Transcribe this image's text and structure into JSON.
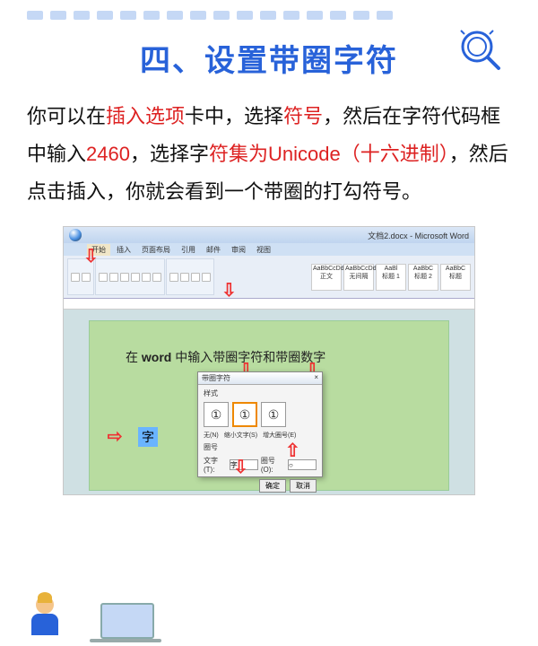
{
  "title": "四、设置带圈字符",
  "paragraph": {
    "p1a": "你可以在",
    "p1b": "插入选项",
    "p1c": "卡中，选择",
    "p1d": "符号",
    "p1e": "，然后在字符代码框中输入",
    "p1f": "2460",
    "p1g": "，选择字",
    "p1h": "符集为Unicode（十六进制）",
    "p1i": "，然后点击插入，你就会看到一个带圈的打勾符号。"
  },
  "word": {
    "window_title": "文档2.docx - Microsoft Word",
    "tabs": [
      "开始",
      "插入",
      "页面布局",
      "引用",
      "邮件",
      "审阅",
      "视图"
    ],
    "style_labels": [
      "AaBbCcDd",
      "AaBbCcDd",
      "AaBl",
      "AaBbC",
      "AaBbC"
    ],
    "style_names": [
      "正文",
      "无间隔",
      "标题 1",
      "标题 2",
      "标题"
    ],
    "page_text_a": "在 ",
    "page_text_b": "word",
    "page_text_c": " 中输入带圈字符和带圈数字",
    "highlighted_char": "字",
    "dialog": {
      "title": "带圈字符",
      "close": "×",
      "section": "样式",
      "options": [
        "①",
        "①",
        "①"
      ],
      "option_labels": [
        "无(N)",
        "缩小文字(S)",
        "增大圈号(E)"
      ],
      "section2": "圈号",
      "text_label": "文字(T):",
      "text_value": "字",
      "ring_label": "圈号(O):",
      "ring_value": "○",
      "ok": "确定",
      "cancel": "取消"
    }
  }
}
